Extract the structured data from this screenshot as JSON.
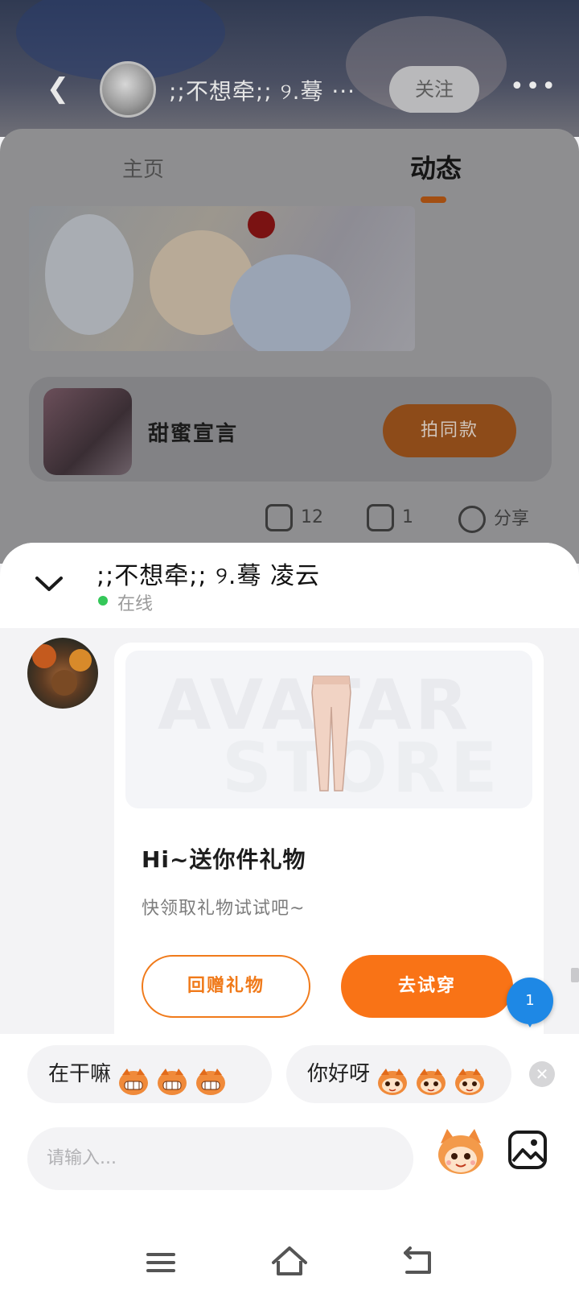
{
  "profile": {
    "username": ";;不想牵;; ୨.蓦 ···",
    "follow_label": "关注",
    "more_label": "•••",
    "tabs": [
      "主页",
      "动态"
    ]
  },
  "post": {
    "product_name": "甜蜜宣言",
    "same_style_label": "拍同款",
    "likes": "12",
    "comments": "1",
    "share_label": "分享"
  },
  "chat": {
    "contact_name": ";;不想牵;; ୨.蓦 凌云",
    "status": "在线"
  },
  "gift_card": {
    "watermark_top": "AVATAR",
    "watermark_bottom": "STORE",
    "title": "Hi~送你件礼物",
    "subtitle": "快领取礼物试试吧~",
    "return_gift_label": "回赠礼物",
    "try_on_label": "去试穿"
  },
  "unread_count": "1",
  "quick_replies": [
    {
      "text": "在干嘛",
      "emoji": "grinning-mascot-icon",
      "emoji_count": 3
    },
    {
      "text": "你好呀",
      "emoji": "smiling-mascot-icon",
      "emoji_count": 3
    }
  ],
  "input": {
    "placeholder": "请输入..."
  },
  "colors": {
    "accent": "#f97316",
    "online": "#34c759",
    "badge": "#1e88e5"
  }
}
